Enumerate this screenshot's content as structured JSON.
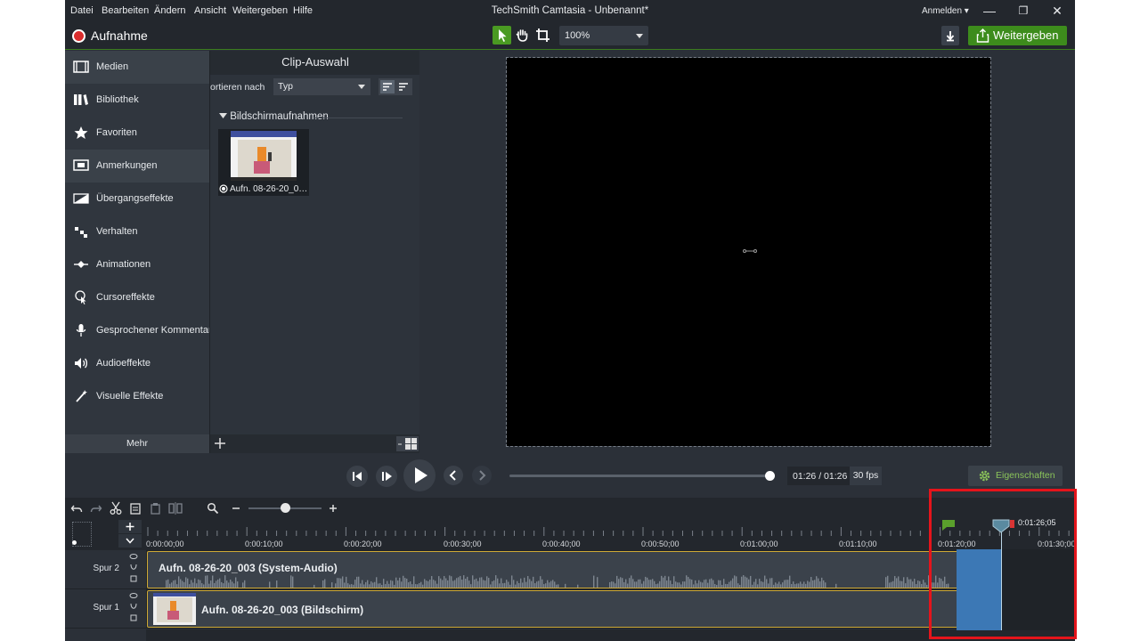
{
  "menu": [
    "Datei",
    "Bearbeiten",
    "Ändern",
    "Ansicht",
    "Weitergeben",
    "Hilfe"
  ],
  "window": {
    "title": "TechSmith Camtasia - Unbenannt*",
    "signin": "Anmelden ▾",
    "minimize": "—",
    "maximize": "❐",
    "close": "✕"
  },
  "toolbar": {
    "record_label": "Aufnahme",
    "zoom_value": "100%",
    "share_label": "Weitergeben",
    "tools": [
      "select-tool-icon",
      "pan-tool-icon",
      "crop-tool-icon"
    ]
  },
  "sidebar": {
    "items": [
      {
        "label": "Medien",
        "icon": "film-icon"
      },
      {
        "label": "Bibliothek",
        "icon": "library-icon"
      },
      {
        "label": "Favoriten",
        "icon": "star-icon"
      },
      {
        "label": "Anmerkungen",
        "icon": "annotation-icon"
      },
      {
        "label": "Übergangseffekte",
        "icon": "transition-icon"
      },
      {
        "label": "Verhalten",
        "icon": "behavior-icon"
      },
      {
        "label": "Animationen",
        "icon": "animation-icon"
      },
      {
        "label": "Cursoreffekte",
        "icon": "cursor-icon"
      },
      {
        "label": "Gesprochener Kommentar",
        "icon": "microphone-icon"
      },
      {
        "label": "Audioeffekte",
        "icon": "speaker-icon"
      },
      {
        "label": "Visuelle Effekte",
        "icon": "magic-wand-icon"
      }
    ],
    "more": "Mehr"
  },
  "bin": {
    "title": "Clip-Auswahl",
    "sort_label": "ortieren nach",
    "sort_value": "Typ",
    "group": "Bildschirmaufnahmen",
    "clip_name": "Aufn. 08-26-20_0…"
  },
  "playback": {
    "time": "01:26 / 01:26",
    "fps": "30 fps",
    "properties": "Eigenschaften"
  },
  "timeline": {
    "ticks": [
      "0:00:00;00",
      "0:00:10;00",
      "0:00:20;00",
      "0:00:30;00",
      "0:00:40;00",
      "0:00:50;00",
      "0:01:00;00",
      "0:01:10;00",
      "0:01:20;00",
      "0:01:30;00"
    ],
    "playhead_time": "0:01:26;05",
    "tracks": [
      {
        "name": "Spur 2",
        "clip": "Aufn. 08-26-20_003 (System-Audio)"
      },
      {
        "name": "Spur 1",
        "clip": "Aufn. 08-26-20_003 (Bildschirm)"
      }
    ]
  },
  "colors": {
    "accent_green": "#3d8c1c",
    "record_red": "#d92d2d",
    "highlight_red": "#e5141b",
    "clip_border": "#cfa935",
    "selection_blue": "#3c78b5"
  }
}
